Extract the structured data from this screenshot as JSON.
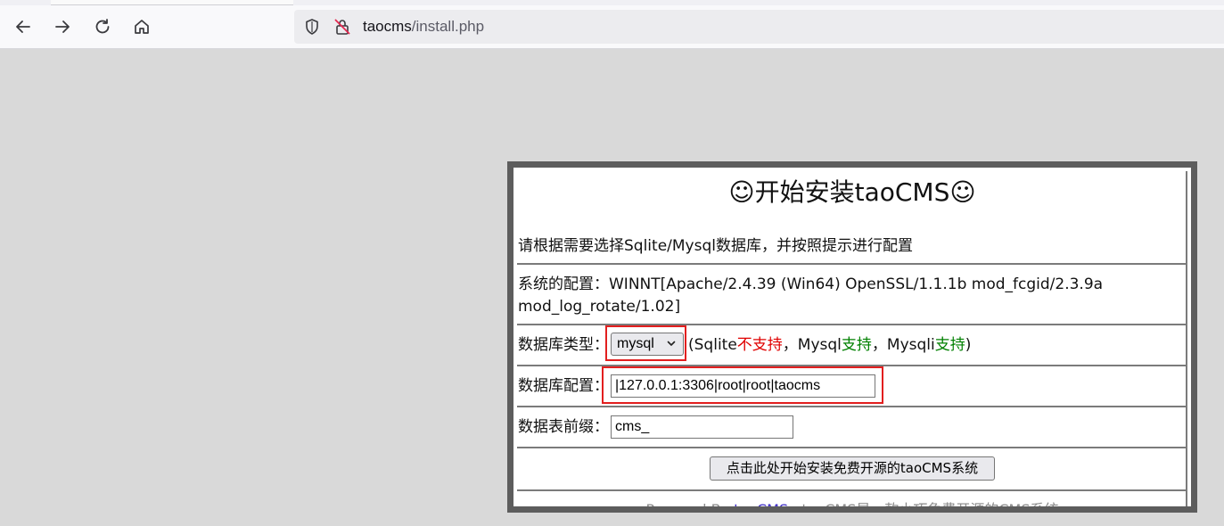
{
  "browser": {
    "url_host": "taocms",
    "url_path": "/install.php"
  },
  "page": {
    "title": "☺开始安装taoCMS☺",
    "intro": "请根据需要选择Sqlite/Mysql数据库，并按照提示进行配置",
    "system_label": "系统的配置：",
    "system_value_line1": "WINNT[Apache/2.4.39 (Win64) OpenSSL/1.1.1b mod_fcgid/2.3.9a",
    "system_value_line2": "mod_log_rotate/1.02]",
    "db_type_label": "数据库类型：",
    "db_type_selected": "mysql",
    "db_support": {
      "open": "(Sqlite",
      "sqlite_status": "不支持",
      "sep1": "，Mysql",
      "mysql_status": "支持",
      "sep2": "，Mysqli",
      "mysqli_status": "支持",
      "close": ")"
    },
    "db_config_label": "数据库配置：",
    "db_config_value": "|127.0.0.1:3306|root|root|taocms",
    "table_prefix_label": "数据表前缀：",
    "table_prefix_value": "cms_",
    "submit_label": "点击此处开始安装免费开源的taoCMS系统",
    "footer": {
      "powered_by": "Powered By ",
      "link": "taoCMS",
      "tagline": "   taoCMS是一款小巧免费开源的CMS系统"
    }
  },
  "colors": {
    "frame_border": "#5d5d5d",
    "highlight": "#e21f1f",
    "unsupported": "#e00000",
    "supported": "#008000"
  }
}
